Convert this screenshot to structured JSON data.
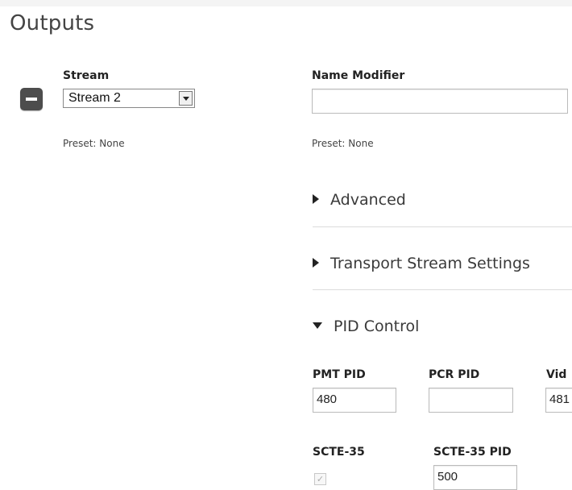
{
  "page": {
    "title": "Outputs"
  },
  "stream": {
    "label": "Stream",
    "selected": "Stream 2",
    "preset": "Preset: None"
  },
  "name_modifier": {
    "label": "Name Modifier",
    "value": "",
    "preset": "Preset: None"
  },
  "sections": {
    "advanced": "Advanced",
    "transport": "Transport Stream Settings",
    "pid_control": "PID Control"
  },
  "pid": {
    "pmt_label": "PMT PID",
    "pmt_value": "480",
    "pcr_label": "PCR PID",
    "pcr_value": "",
    "video_label": "Vid",
    "video_value": "481",
    "scte_label": "SCTE-35",
    "scte_checked": true,
    "scte_pid_label": "SCTE-35 PID",
    "scte_pid_value": "500"
  },
  "icons": {
    "remove": "minus-icon",
    "dropdown": "chevron-down-icon",
    "collapsed": "caret-right-icon",
    "expanded": "caret-down-icon",
    "check": "checkmark-icon"
  }
}
